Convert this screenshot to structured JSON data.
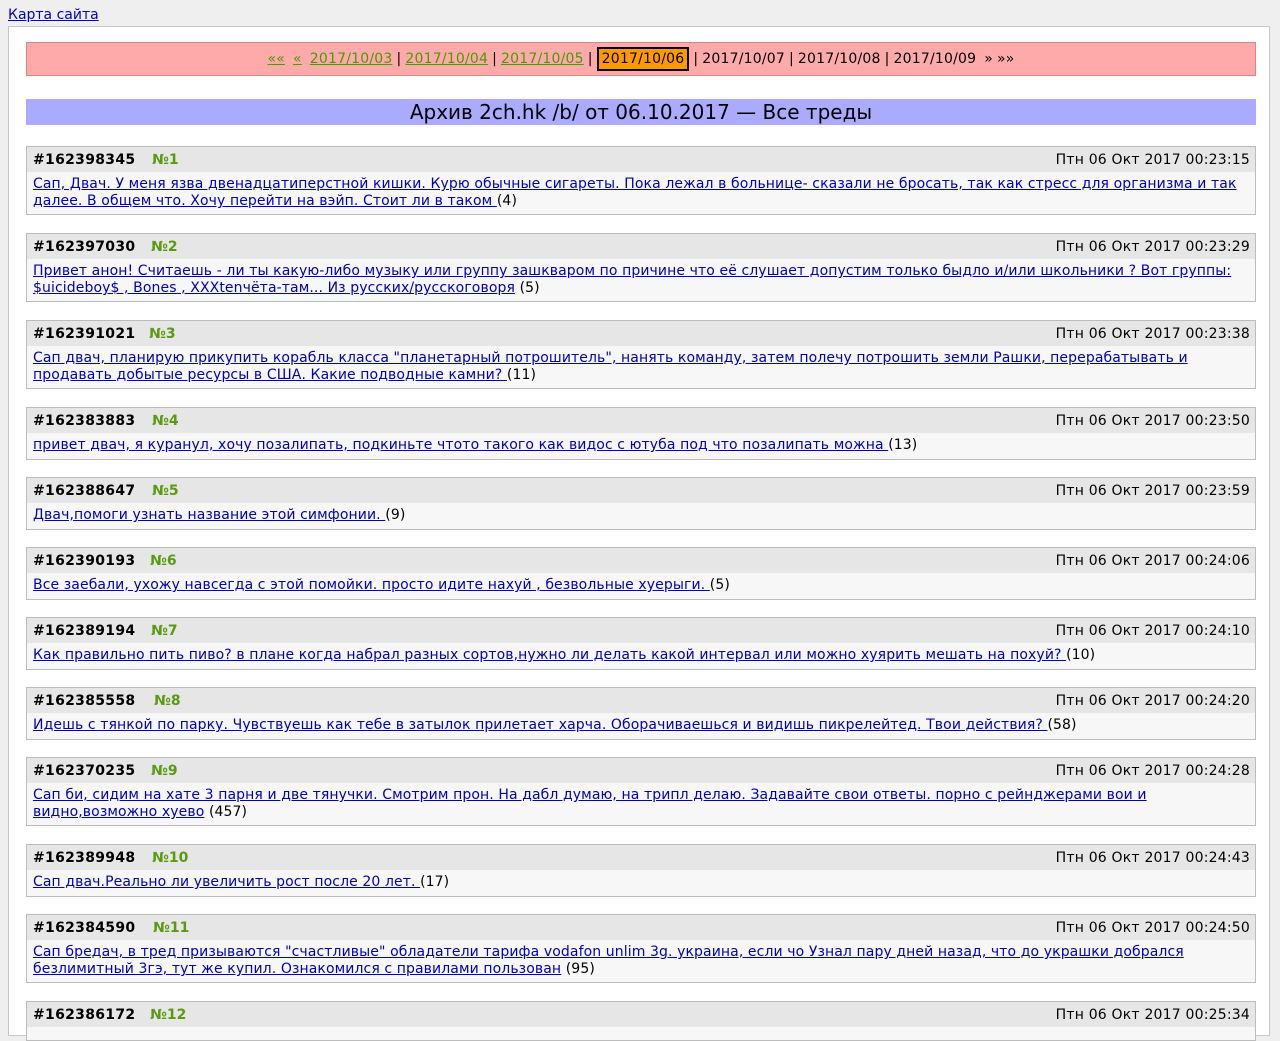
{
  "sitemap_label": "Карта сайта",
  "datebar": {
    "first_label": "««",
    "prev_label": "«",
    "links": [
      "2017/10/03",
      "2017/10/04",
      "2017/10/05"
    ],
    "current": "2017/10/06",
    "plain": [
      "2017/10/07",
      "2017/10/08",
      "2017/10/09"
    ],
    "next_label": "»",
    "last_label": "»»",
    "separator": "|"
  },
  "archive_title": "Архив 2ch.hk /b/ от 06.10.2017 — Все треды",
  "threads": [
    {
      "id": "#162398345",
      "num": "№1",
      "date": "Птн 06 Окт 2017 00:23:15",
      "text": "Сап, Двач. У меня язва двенадцатиперстной кишки. Курю обычные сигареты. Пока лежал в больнице- сказали не бросать, так как стресс для организма и так далее. В общем что. Хочу перейти на вэйп. Стоит ли в таком ",
      "count": "(4)"
    },
    {
      "id": "#162397030",
      "num": "№2",
      "date": "Птн 06 Окт 2017 00:23:29",
      "text": "Привет анон! Считаешь - ли ты какую-либо музыку или группу зашкваром по причине что её слушает допустим только быдло и/или школьники ? Вот группы: $uicideboy$ , Bones , XXXtenчёта-там... Из русских/русскоговоря",
      "count": "(5)"
    },
    {
      "id": "#162391021",
      "num": "№3",
      "date": "Птн 06 Окт 2017 00:23:38",
      "text": "Сап двач, планирую прикупить корабль класса \"планетарный потрошитель\", нанять команду, затем полечу потрошить земли Рашки, перерабатывать и продавать добытые ресурсы в США. Какие подводные камни? ",
      "count": "(11)"
    },
    {
      "id": "#162383883",
      "num": "№4",
      "date": "Птн 06 Окт 2017 00:23:50",
      "text": "привет двач, я куранул, хочу позалипать, подкиньте чтото такого как видос с ютуба под что позалипать можна ",
      "count": "(13)"
    },
    {
      "id": "#162388647",
      "num": "№5",
      "date": "Птн 06 Окт 2017 00:23:59",
      "text": "Двач,помоги узнать название этой симфонии. ",
      "count": "(9)"
    },
    {
      "id": "#162390193",
      "num": "№6",
      "date": "Птн 06 Окт 2017 00:24:06",
      "text": "Все заебали, ухожу навсегда с этой помойки. просто идите нахуй , безвольные хуерыги. ",
      "count": "(5)"
    },
    {
      "id": "#162389194",
      "num": "№7",
      "date": "Птн 06 Окт 2017 00:24:10",
      "text": "Как правильно пить пиво? в плане когда набрал разных сортов,нужно ли делать какой интервал или можно хуярить мешать на похуй? ",
      "count": "(10)"
    },
    {
      "id": "#162385558",
      "num": "№8",
      "date": "Птн 06 Окт 2017 00:24:20",
      "text": "Идешь с тянкой по парку. Чувствуешь как тебе в затылок прилетает харча. Оборачиваешься и видишь пикрелейтед. Твои действия? ",
      "count": "(58)"
    },
    {
      "id": "#162370235",
      "num": "№9",
      "date": "Птн 06 Окт 2017 00:24:28",
      "text": "Сап би, сидим на хате 3 парня и две тянучки. Смотрим прон. На дабл думаю, на трипл делаю. Задавайте свои ответы. порно с рейнджерами вои и видно,возможно хуево",
      "count": "(457)"
    },
    {
      "id": "#162389948",
      "num": "№10",
      "date": "Птн 06 Окт 2017 00:24:43",
      "text": "Сап двач.Реально ли увеличить рост после 20 лет. ",
      "count": "(17)"
    },
    {
      "id": "#162384590",
      "num": "№11",
      "date": "Птн 06 Окт 2017 00:24:50",
      "text": "Сап бредач, в тред призываются \"счастливые\" обладатели тарифа vodafon unlim 3g. украина, если чо Узнал пару дней назад, что до украшки добрался безлимитный 3гэ, тут же купил. Ознакомился с правилами пользован",
      "count": "(95)"
    },
    {
      "id": "#162386172",
      "num": "№12",
      "date": "Птн 06 Окт 2017 00:25:34",
      "text": "",
      "count": ""
    }
  ]
}
